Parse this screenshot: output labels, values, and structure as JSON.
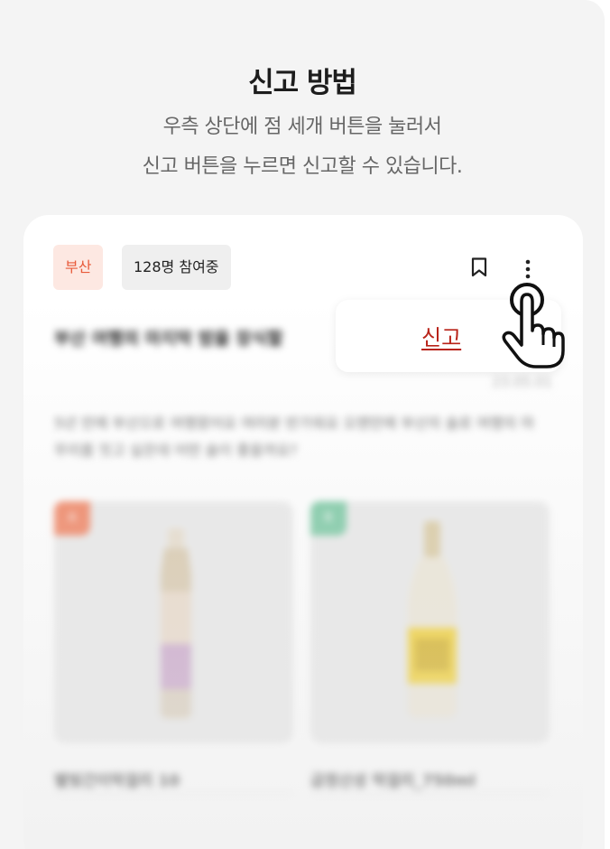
{
  "header": {
    "title": "신고 방법",
    "desc_line1": "우측 상단에 점 세개 버튼을 눌러서",
    "desc_line2": "신고 버튼을 누르면 신고할 수 있습니다."
  },
  "card": {
    "region_tag": "부산",
    "participants_tag": "128명 참여중",
    "post_title": "부산 여행의 마지막 밤을 장식할",
    "post_date": "23.05.01",
    "post_body": "5년 만에 부산으로 여행왔어요 여러분 반가워요 오랜만에 부산의 술로 여행의 마무리를 짓고 싶은데 어떤 술이 좋을까요?",
    "products": [
      {
        "badge": "A",
        "name": "별빛간이막걸리 10",
        "badge_color": "#f08260"
      },
      {
        "badge": "B",
        "name": "금정산성 막걸리_750ml",
        "badge_color": "#79c8a2"
      }
    ]
  },
  "menu": {
    "report_label": "신고"
  },
  "icons": {
    "bookmark": "bookmark-icon",
    "more": "more-vertical-icon",
    "pointer": "pointing-hand-icon"
  },
  "colors": {
    "accent_red": "#b82218",
    "region_tag_text": "#e85a3a",
    "region_tag_bg": "#fde8e2"
  }
}
